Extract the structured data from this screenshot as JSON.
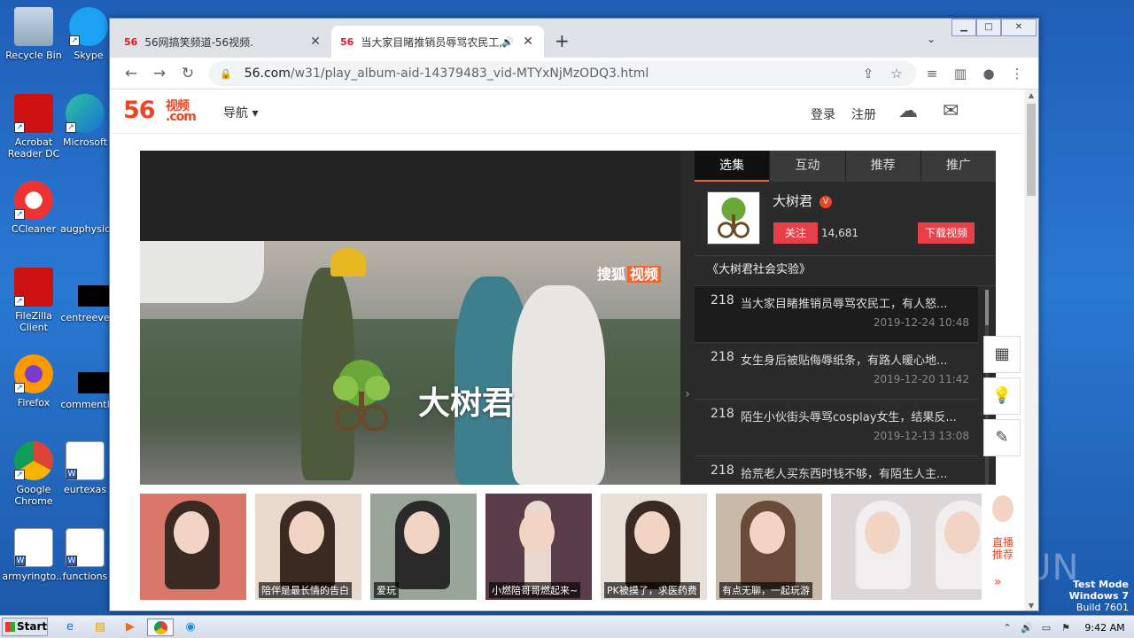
{
  "desktop": {
    "icons": [
      {
        "label": "Recycle Bin",
        "icon": "recycle-bin-icon"
      },
      {
        "label": "Skype",
        "icon": "skype-icon"
      },
      {
        "label": "Acrobat Reader DC",
        "icon": "acrobat-icon"
      },
      {
        "label": "Microsoft",
        "icon": "edge-icon"
      },
      {
        "label": "CCleaner",
        "icon": "ccleaner-icon"
      },
      {
        "label": "augphysic",
        "icon": "file-icon"
      },
      {
        "label": "FileZilla Client",
        "icon": "filezilla-icon"
      },
      {
        "label": "centreeve",
        "icon": "file-icon"
      },
      {
        "label": "Firefox",
        "icon": "firefox-icon"
      },
      {
        "label": "commentl",
        "icon": "file-icon"
      },
      {
        "label": "Google Chrome",
        "icon": "chrome-icon"
      },
      {
        "label": "eurtexas",
        "icon": "word-icon"
      },
      {
        "label": "armyringto...",
        "icon": "word-icon"
      },
      {
        "label": "functions",
        "icon": "word-icon"
      }
    ],
    "watermark": {
      "line1": "Test Mode",
      "line2": "Windows 7",
      "line3": "Build 7601"
    },
    "anyrun": "ANY RUN"
  },
  "browser": {
    "tabs": [
      {
        "favicon": "56",
        "title": "56网搞笑频道-56视频.",
        "close": "✕"
      },
      {
        "favicon": "56",
        "title": "当大家目睹推销员辱骂农民工,",
        "close": "✕",
        "audio": "🔊"
      }
    ],
    "new_tab": "+",
    "tab_search": "⌄",
    "window_controls": {
      "minimize": "▁",
      "maximize": "□",
      "close": "✕"
    },
    "nav": {
      "back": "←",
      "forward": "→",
      "reload": "↻"
    },
    "url": {
      "host": "56.com",
      "path": "/w31/play_album-aid-14379483_vid-MTYxNjMzODQ3.html"
    },
    "toolbar_icons": {
      "share": "⇪",
      "bookmark": "☆",
      "media": "≡",
      "sidepanel": "▥",
      "profile": "●",
      "menu": "⋮"
    }
  },
  "site": {
    "logo": {
      "num": "56",
      "cn": "视频",
      "com": ".com"
    },
    "nav_dropdown": "导航 ▾",
    "login": "登录",
    "register": "注册",
    "upload_icon": "☁",
    "mail_icon": "✉"
  },
  "player": {
    "brand_text": "大树君",
    "sohu": "搜狐",
    "sohu_badge": "视频",
    "toggle": "›"
  },
  "sidebar": {
    "tabs": [
      "选集",
      "互动",
      "推荐",
      "推广"
    ],
    "uploader": {
      "name": "大树君",
      "badge": "V",
      "follow": "关注",
      "fans": "14,681",
      "download": "下载视频"
    },
    "album_title": "《大树君社会实验》",
    "episodes": [
      {
        "num": "218",
        "title": "当大家目睹推销员辱骂农民工，有人怒...",
        "date": "2019-12-24 10:48"
      },
      {
        "num": "218",
        "title": "女生身后被贴侮辱纸条，有路人暖心地...",
        "date": "2019-12-20 11:42"
      },
      {
        "num": "218",
        "title": "陌生小伙街头辱骂cosplay女生，结果反...",
        "date": "2019-12-13 13:08"
      },
      {
        "num": "218",
        "title": "拾荒老人买东西时钱不够，有陌生人主...",
        "date": ""
      }
    ]
  },
  "float_tools": [
    "qr-code-icon",
    "lightbulb-icon",
    "edit-icon"
  ],
  "float_glyphs": [
    "▦",
    "💡",
    "✎"
  ],
  "thumbs": [
    {
      "caption": "",
      "bg": "#d9776a"
    },
    {
      "caption": "陪伴是最长情的告白",
      "bg": "#e8d9cc"
    },
    {
      "caption": "爱玩",
      "bg": "#9aa59a"
    },
    {
      "caption": "小燃陪哥哥燃起来~",
      "bg": "#5a3c4a"
    },
    {
      "caption": "PK被摸了，求医药费",
      "bg": "#e8dfd8"
    },
    {
      "caption": "有点无聊，一起玩游",
      "bg": "#c9b9a8"
    },
    {
      "caption": "",
      "bg": "#dcd6d6"
    }
  ],
  "live": {
    "label": "直播推荐",
    "arrow": "»"
  },
  "taskbar": {
    "start": "Start",
    "clock": "9:42 AM",
    "tray": [
      "⌃",
      "🔊",
      "▭",
      "⚑"
    ]
  }
}
